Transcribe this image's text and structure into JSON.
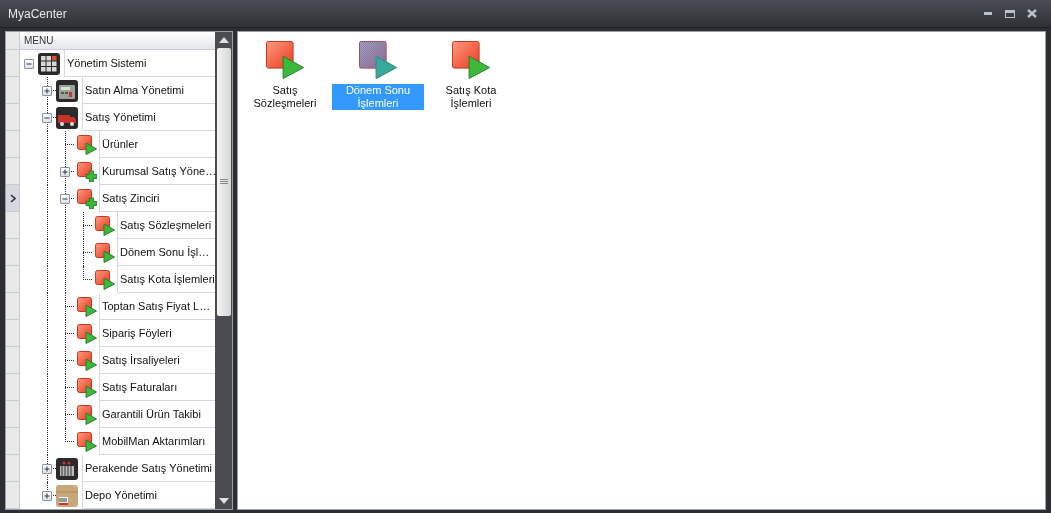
{
  "window": {
    "title": "MyaCenter"
  },
  "menu": {
    "header": "MENU",
    "nodes": [
      {
        "label": "Yönetim Sistemi",
        "kind": "grid",
        "expanded": true,
        "current": false,
        "children": [
          {
            "label": "Satın Alma Yönetimi",
            "kind": "calculator",
            "expanded": false,
            "current": false
          },
          {
            "label": "Satış Yönetimi",
            "kind": "truck",
            "expanded": true,
            "current": false,
            "children": [
              {
                "label": "Ürünler",
                "kind": "run",
                "current": false
              },
              {
                "label": "Kurumsal Satış Yöne…",
                "kind": "add",
                "expanded": false,
                "current": false
              },
              {
                "label": "Satış Zinciri",
                "kind": "add",
                "expanded": true,
                "current": true,
                "children": [
                  {
                    "label": "Satış Sözleşmeleri",
                    "kind": "run",
                    "current": false
                  },
                  {
                    "label": "Dönem Sonu İşl…",
                    "kind": "run",
                    "current": false
                  },
                  {
                    "label": "Satış Kota İşlemleri",
                    "kind": "run",
                    "current": false
                  }
                ]
              },
              {
                "label": "Toptan Satış Fiyat L…",
                "kind": "run",
                "current": false
              },
              {
                "label": "Sipariş Föyleri",
                "kind": "run",
                "current": false
              },
              {
                "label": "Satış İrsaliyeleri",
                "kind": "run",
                "current": false
              },
              {
                "label": "Satış Faturaları",
                "kind": "run",
                "current": false
              },
              {
                "label": "Garantili Ürün Takibi",
                "kind": "run",
                "current": false
              },
              {
                "label": "MobilMan Aktarımları",
                "kind": "run",
                "current": false
              }
            ]
          },
          {
            "label": "Perakende Satış Yönetimi",
            "kind": "register",
            "expanded": false,
            "current": false
          },
          {
            "label": "Depo Yönetimi",
            "kind": "box",
            "expanded": false,
            "current": false
          }
        ]
      }
    ]
  },
  "items": [
    {
      "label": "Satış Sözleşmeleri",
      "selected": false
    },
    {
      "label": "Dönem Sonu İşlemleri",
      "selected": true
    },
    {
      "label": "Satış Kota İşlemleri",
      "selected": false
    }
  ]
}
